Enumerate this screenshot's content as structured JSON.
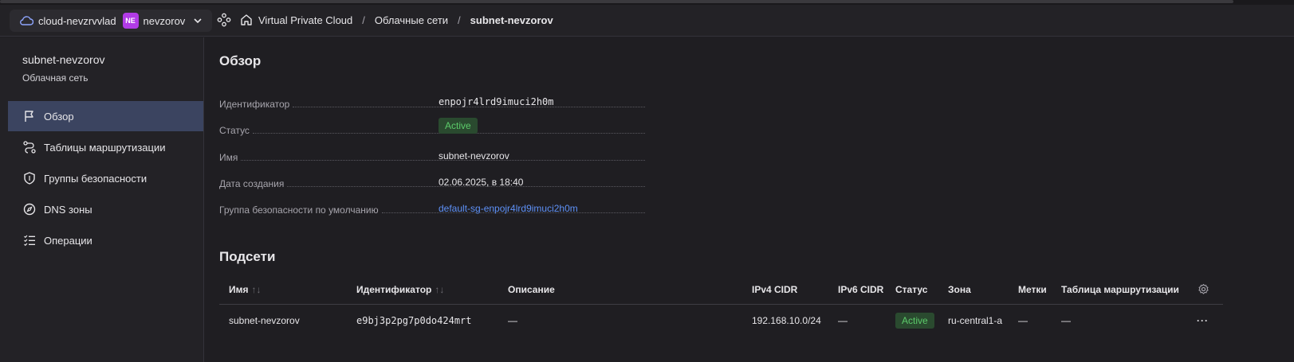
{
  "header": {
    "cloud_name": "cloud-nevzrvvlad",
    "folder_badge": "NE",
    "folder_name": "nevzorov",
    "breadcrumbs": [
      "Virtual Private Cloud",
      "Облачные сети",
      "subnet-nevzorov"
    ],
    "separator": "/"
  },
  "sidebar": {
    "title": "subnet-nevzorov",
    "subtitle": "Облачная сеть",
    "items": [
      {
        "label": "Обзор",
        "icon": "flag-icon",
        "active": true
      },
      {
        "label": "Таблицы маршрутизации",
        "icon": "route-icon",
        "active": false
      },
      {
        "label": "Группы безопасности",
        "icon": "shield-icon",
        "active": false
      },
      {
        "label": "DNS зоны",
        "icon": "compass-icon",
        "active": false
      },
      {
        "label": "Операции",
        "icon": "list-check-icon",
        "active": false
      }
    ]
  },
  "overview": {
    "title": "Обзор",
    "props": [
      {
        "label": "Идентификатор",
        "value": "enpojr4lrd9imuci2h0m"
      },
      {
        "label": "Статус",
        "value": "Active"
      },
      {
        "label": "Имя",
        "value": "subnet-nevzorov"
      },
      {
        "label": "Дата создания",
        "value": "02.06.2025, в 18:40"
      },
      {
        "label": "Группа безопасности по умолчанию",
        "value": "default-sg-enpojr4lrd9imuci2h0m"
      }
    ]
  },
  "subnets": {
    "title": "Подсети",
    "columns": [
      "Имя",
      "Идентификатор",
      "Описание",
      "IPv4 CIDR",
      "IPv6 CIDR",
      "Статус",
      "Зона",
      "Метки",
      "Таблица маршрутизации"
    ],
    "sort_glyph": "↑↓",
    "rows": [
      {
        "name": "subnet-nevzorov",
        "id": "e9bj3p2pg7p0do424mrt",
        "description": "—",
        "ipv4": "192.168.10.0/24",
        "ipv6": "—",
        "status": "Active",
        "zone": "ru-central1-a",
        "labels": "—",
        "route_table": "—",
        "more": "···"
      }
    ]
  },
  "colors": {
    "accent": "#5e91f7",
    "status_active_bg": "#2a4a2f",
    "status_active_fg": "#5ccb6a",
    "sidebar_active": "#3b4460",
    "folder_badge": "#b13be6"
  }
}
